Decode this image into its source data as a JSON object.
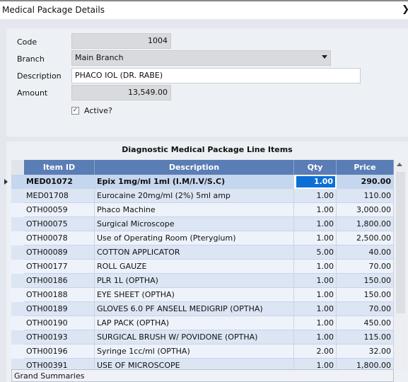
{
  "window": {
    "title": "Medical Package Details",
    "close_icon": "close-icon"
  },
  "form": {
    "code_label": "Code",
    "code_value": "1004",
    "branch_label": "Branch",
    "branch_value": "Main Branch",
    "description_label": "Description",
    "description_value": "PHACO IOL (DR. RABE)",
    "amount_label": "Amount",
    "amount_value": "13,549.00",
    "active_label": "Active?",
    "active_checked": true
  },
  "grid": {
    "title": "Diagnostic Medical Package Line Items",
    "columns": [
      "Item ID",
      "Description",
      "Qty",
      "Price"
    ],
    "rows": [
      [
        "MED01072",
        "Epix 1mg/ml 1ml (I.M/I.V/S.C)",
        "1.00",
        "290.00"
      ],
      [
        "MED01708",
        "Eurocaine 20mg/ml (2%) 5ml amp",
        "1.00",
        "110.00"
      ],
      [
        "OTH00059",
        "Phaco Machine",
        "1.00",
        "3,000.00"
      ],
      [
        "OTH00075",
        "Surgical Microscope",
        "1.00",
        "1,800.00"
      ],
      [
        "OTH00078",
        "Use of Operating Room (Pterygium)",
        "1.00",
        "2,500.00"
      ],
      [
        "OTH00089",
        "COTTON APPLICATOR",
        "5.00",
        "40.00"
      ],
      [
        "OTH00177",
        "ROLL GAUZE",
        "1.00",
        "70.00"
      ],
      [
        "OTH00186",
        "PLR 1L (OPTHA)",
        "1.00",
        "150.00"
      ],
      [
        "OTH00188",
        "EYE SHEET (OPTHA)",
        "1.00",
        "150.00"
      ],
      [
        "OTH00189",
        "GLOVES 6.0 PF ANSELL MEDIGRIP (OPTHA)",
        "1.00",
        "70.00"
      ],
      [
        "OTH00190",
        "LAP PACK (OPTHA)",
        "1.00",
        "450.00"
      ],
      [
        "OTH00193",
        "SURGICAL BRUSH W/ POVIDONE (OPTHA)",
        "1.00",
        "115.00"
      ],
      [
        "OTH00196",
        "Syringe 1cc/ml (OPTHA)",
        "2.00",
        "32.00"
      ],
      [
        "OTH00391",
        "USE OF MICROSCOPE",
        "1.00",
        "1,800.00"
      ]
    ],
    "selected_row": 0,
    "summary_label": "Grand Summaries"
  },
  "colors": {
    "header": "#5a7db5",
    "row_a": "#eef3fb",
    "row_b": "#dce5f3",
    "selected": "#c5d6ef",
    "edit_highlight": "#0b6fd6"
  }
}
